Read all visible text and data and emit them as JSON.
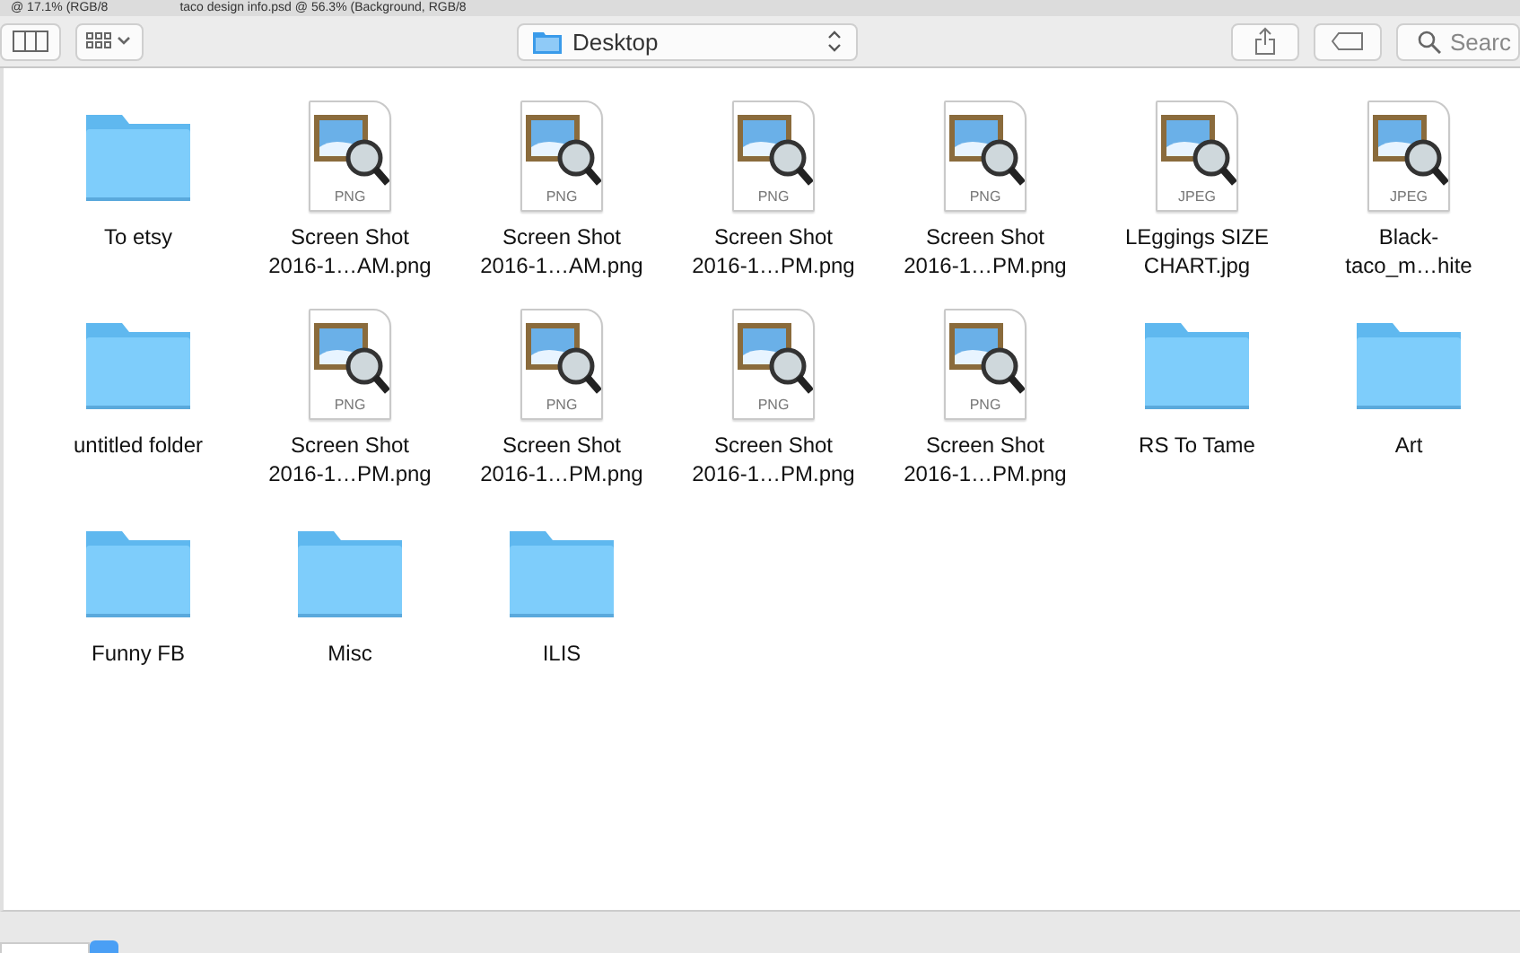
{
  "background_tabs": [
    "@ 17.1% (RGB/8",
    "taco design info.psd @ 56.3% (Background, RGB/8"
  ],
  "toolbar": {
    "path": "Desktop",
    "search": {
      "placeholder": "Searc"
    }
  },
  "items": [
    {
      "kind": "folder",
      "name": [
        "To etsy"
      ]
    },
    {
      "kind": "file",
      "badge": "PNG",
      "name": [
        "Screen Shot",
        "2016-1…AM.png"
      ]
    },
    {
      "kind": "file",
      "badge": "PNG",
      "name": [
        "Screen Shot",
        "2016-1…AM.png"
      ]
    },
    {
      "kind": "file",
      "badge": "PNG",
      "name": [
        "Screen Shot",
        "2016-1…PM.png"
      ]
    },
    {
      "kind": "file",
      "badge": "PNG",
      "name": [
        "Screen Shot",
        "2016-1…PM.png"
      ]
    },
    {
      "kind": "file",
      "badge": "JPEG",
      "name": [
        "LEggings SIZE",
        "CHART.jpg"
      ]
    },
    {
      "kind": "file",
      "badge": "JPEG",
      "name": [
        "Black-",
        "taco_m…hite"
      ]
    },
    {
      "kind": "folder",
      "name": [
        "untitled folder"
      ]
    },
    {
      "kind": "file",
      "badge": "PNG",
      "name": [
        "Screen Shot",
        "2016-1…PM.png"
      ]
    },
    {
      "kind": "file",
      "badge": "PNG",
      "name": [
        "Screen Shot",
        "2016-1…PM.png"
      ]
    },
    {
      "kind": "file",
      "badge": "PNG",
      "name": [
        "Screen Shot",
        "2016-1…PM.png"
      ]
    },
    {
      "kind": "file",
      "badge": "PNG",
      "name": [
        "Screen Shot",
        "2016-1…PM.png"
      ]
    },
    {
      "kind": "folder",
      "name": [
        "RS To Tame"
      ]
    },
    {
      "kind": "folder",
      "name": [
        "Art"
      ]
    },
    {
      "kind": "folder",
      "name": [
        "Funny FB"
      ]
    },
    {
      "kind": "folder",
      "name": [
        "Misc"
      ]
    },
    {
      "kind": "folder",
      "name": [
        "ILIS"
      ]
    }
  ]
}
